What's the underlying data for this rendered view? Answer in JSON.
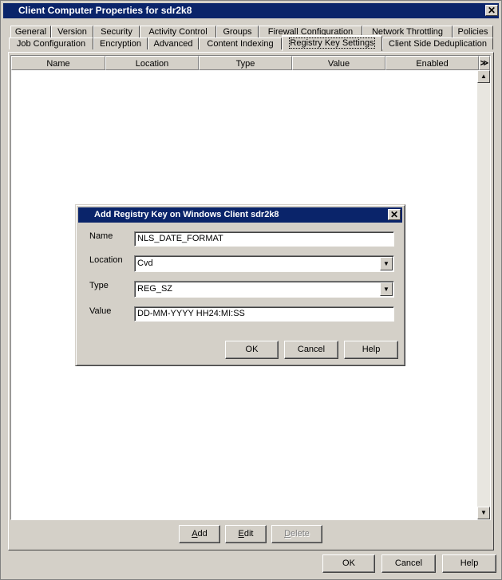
{
  "window": {
    "title": "Client Computer Properties for sdr2k8",
    "close_glyph": "✕"
  },
  "tabs_row1": [
    {
      "label": "General"
    },
    {
      "label": "Version"
    },
    {
      "label": "Security"
    },
    {
      "label": "Activity Control"
    },
    {
      "label": "Groups"
    },
    {
      "label": "Firewall Configuration"
    },
    {
      "label": "Network Throttling"
    },
    {
      "label": "Policies"
    }
  ],
  "tabs_row2": [
    {
      "label": "Job Configuration"
    },
    {
      "label": "Encryption"
    },
    {
      "label": "Advanced"
    },
    {
      "label": "Content Indexing"
    },
    {
      "label": "Registry Key Settings",
      "active": true
    },
    {
      "label": "Client Side Deduplication"
    }
  ],
  "table": {
    "columns": [
      "Name",
      "Location",
      "Type",
      "Value",
      "Enabled"
    ],
    "rows": [],
    "menu_glyph": "≫"
  },
  "panel_buttons": {
    "add": {
      "underline": "A",
      "rest": "dd"
    },
    "edit": {
      "underline": "E",
      "rest": "dit"
    },
    "delete": {
      "underline": "D",
      "rest": "elete",
      "enabled": false
    }
  },
  "footer_buttons": {
    "ok": "OK",
    "cancel": "Cancel",
    "help": "Help"
  },
  "dialog": {
    "title": "Add Registry Key on Windows Client  sdr2k8",
    "close_glyph": "✕",
    "fields": {
      "name": {
        "label": "Name",
        "value": "NLS_DATE_FORMAT"
      },
      "location": {
        "label": "Location",
        "value": "Cvd"
      },
      "type": {
        "label": "Type",
        "value": "REG_SZ"
      },
      "value": {
        "label": "Value",
        "value": "DD-MM-YYYY HH24:MI:SS"
      }
    },
    "buttons": {
      "ok": "OK",
      "cancel": "Cancel",
      "help": "Help"
    }
  }
}
